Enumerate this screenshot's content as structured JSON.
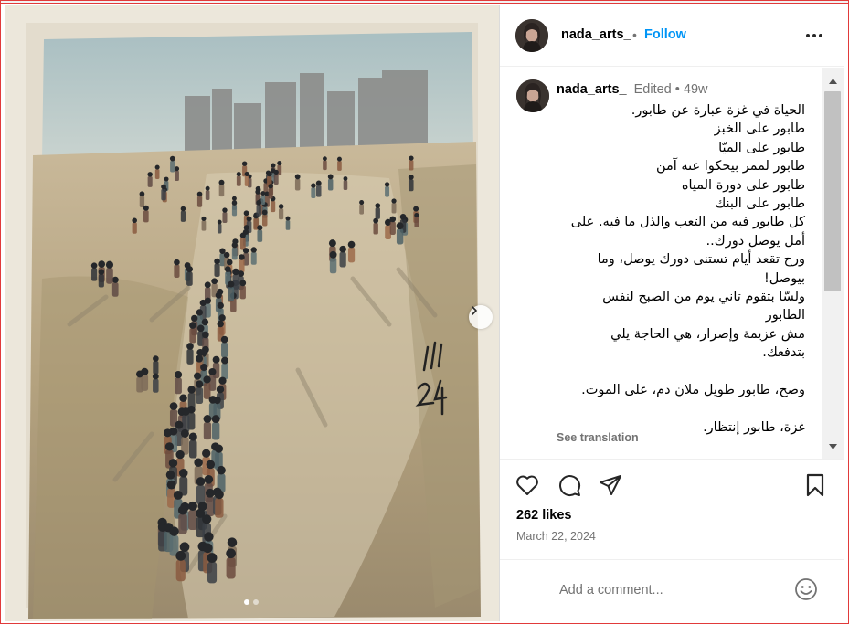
{
  "post": {
    "username": "nada_arts_",
    "separator": "•",
    "follow_label": "Follow",
    "more_icon": "more-horizontal-icon",
    "carousel": {
      "slide_count": 2,
      "active_slide": 1,
      "next_icon": "chevron-right-icon"
    }
  },
  "caption": {
    "username": "nada_arts_",
    "edited_label": "Edited",
    "separator": "•",
    "age": "49w",
    "lines": [
      "الحياة في غزة عبارة عن طابور.",
      "طابور على الخبز",
      "طابور على الميّا",
      "طابور لممر بيحكوا عنه آمن",
      "طابور على دورة المياه",
      "طابور على البنك",
      "كل طابور فيه من التعب والذل ما فيه. على",
      "أمل يوصل دورك..",
      "ورح تقعد أيام تستنى دورك يوصل، وما",
      "بيوصل!",
      "ولسّا بتقوم تاني يوم من الصبح لنفس",
      "الطابور",
      "مش عزيمة وإصرار، هي الحاجة يلي",
      "بتدفعك.",
      "",
      "وصح، طابور طويل ملان دم، على الموت.",
      "",
      "غزة، طابور إنتظار."
    ],
    "see_translation": "See translation"
  },
  "actions": {
    "like_icon": "heart-icon",
    "comment_icon": "comment-icon",
    "share_icon": "share-icon",
    "save_icon": "bookmark-icon"
  },
  "likes_text": "262 likes",
  "date_text": "March 22, 2024",
  "comment": {
    "placeholder": "Add a comment...",
    "emoji_icon": "emoji-icon"
  },
  "colors": {
    "follow_blue": "#0095f6",
    "muted_text": "#737373",
    "border": "#dbdbdb"
  }
}
